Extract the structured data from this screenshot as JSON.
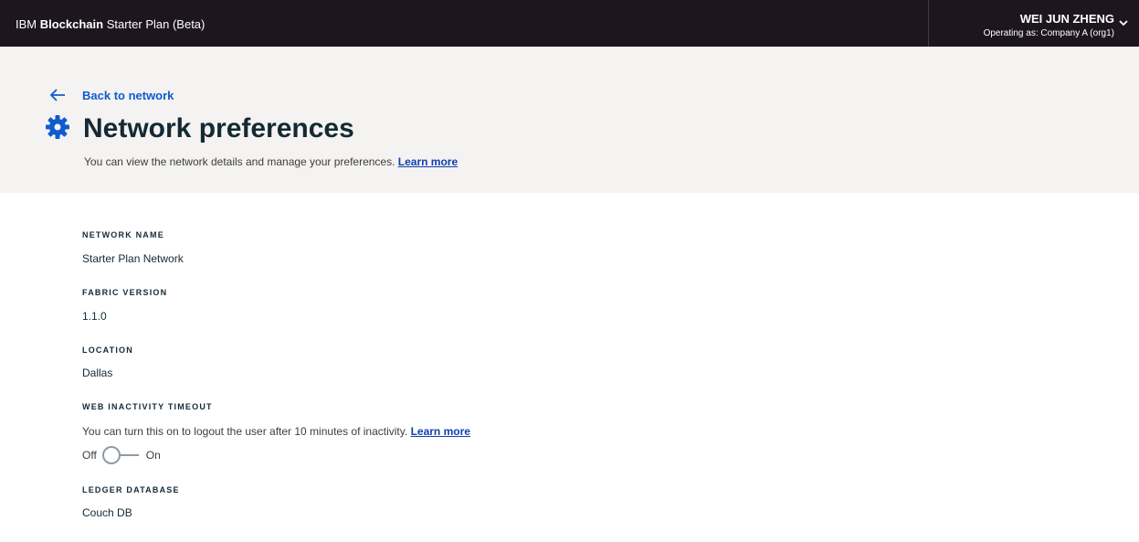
{
  "topbar": {
    "brand_prefix": "IBM ",
    "brand_bold": "Blockchain",
    "brand_suffix": " Starter Plan (Beta)",
    "user_name": "WEI JUN ZHENG",
    "operating_as": "Operating as: Company A (org1)"
  },
  "header": {
    "back_label": "Back to network",
    "title": "Network preferences",
    "subtitle": "You can view the network details and manage your preferences.",
    "learn_more": "Learn more"
  },
  "fields": {
    "network_name": {
      "label": "NETWORK NAME",
      "value": "Starter Plan Network"
    },
    "fabric_version": {
      "label": "FABRIC VERSION",
      "value": "1.1.0"
    },
    "location": {
      "label": "LOCATION",
      "value": "Dallas"
    },
    "web_timeout": {
      "label": "WEB INACTIVITY TIMEOUT",
      "description": "You can turn this on to logout the user after 10 minutes of inactivity.",
      "learn_more": "Learn more",
      "off_label": "Off",
      "on_label": "On",
      "enabled": false
    },
    "ledger_database": {
      "label": "LEDGER DATABASE",
      "value": "Couch DB"
    }
  },
  "colors": {
    "topbar_bg": "#1d161f",
    "header_bg": "#f4f3f1",
    "link": "#0f5bd0",
    "icon_blue": "#0f5bd0"
  }
}
